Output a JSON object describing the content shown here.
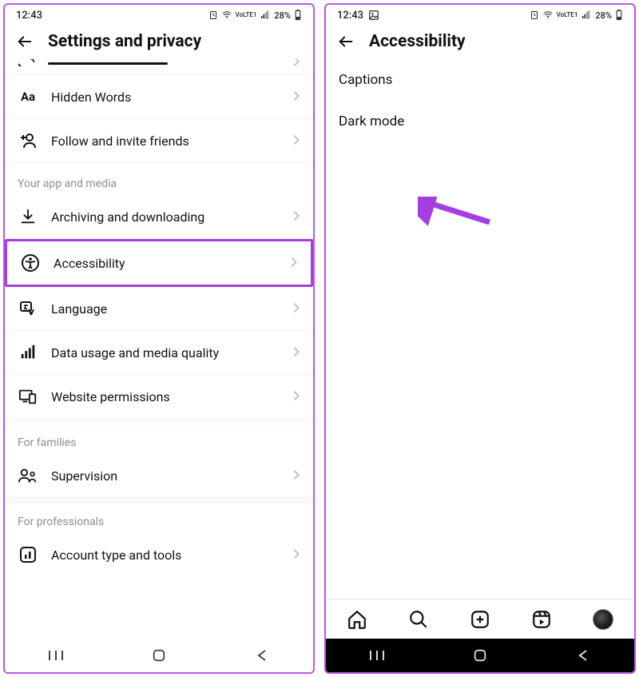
{
  "status": {
    "time": "12:43",
    "battery_text": "28%",
    "network_label": "VoLTE1"
  },
  "left": {
    "title": "Settings and privacy",
    "rows": {
      "hidden_words": "Hidden Words",
      "follow_invite": "Follow and invite friends",
      "archiving": "Archiving and downloading",
      "accessibility": "Accessibility",
      "language": "Language",
      "data_usage": "Data usage and media quality",
      "website_perm": "Website permissions",
      "supervision": "Supervision",
      "account_type": "Account type and tools"
    },
    "sections": {
      "app_media": "Your app and media",
      "families": "For families",
      "professionals": "For professionals"
    }
  },
  "right": {
    "title": "Accessibility",
    "items": {
      "captions": "Captions",
      "dark_mode": "Dark mode"
    }
  }
}
